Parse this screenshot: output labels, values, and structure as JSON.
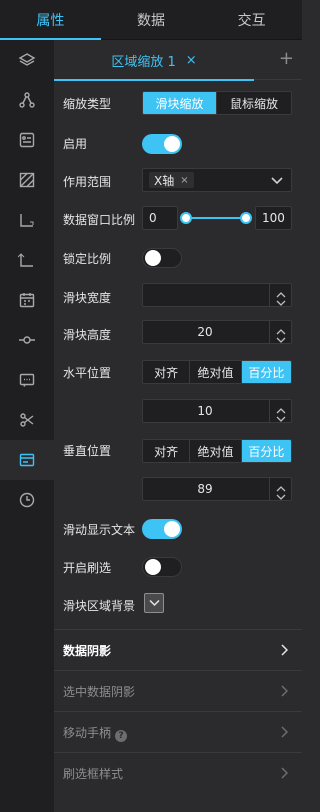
{
  "top_tabs": [
    {
      "label": "属性",
      "active": true
    },
    {
      "label": "数据",
      "active": false
    },
    {
      "label": "交互",
      "active": false
    }
  ],
  "rail_icons": [
    "layers-icon",
    "graph-nodes-icon",
    "card-list-icon",
    "texture-icon",
    "axis-x-icon",
    "axis-y-icon",
    "calendar-icon",
    "timeline-icon",
    "message-icon",
    "scissors-icon",
    "data-zoom-icon",
    "clock-icon"
  ],
  "sub_tab": {
    "label": "区域缩放 1",
    "close": "×",
    "add": "+"
  },
  "zoom_type": {
    "label": "缩放类型",
    "options": [
      "滑块缩放",
      "鼠标缩放"
    ],
    "selected": "滑块缩放"
  },
  "enabled": {
    "label": "启用",
    "value": true
  },
  "scope": {
    "label": "作用范围",
    "tag": "X轴",
    "tag_close": "×"
  },
  "window_ratio": {
    "label": "数据窗口比例",
    "start": "0",
    "end": "100"
  },
  "lock_ratio": {
    "label": "锁定比例",
    "value": false
  },
  "slider_width": {
    "label": "滑块宽度",
    "value": ""
  },
  "slider_height": {
    "label": "滑块高度",
    "value": "20"
  },
  "h_position": {
    "label": "水平位置",
    "options": [
      "对齐",
      "绝对值",
      "百分比"
    ],
    "selected": "百分比",
    "value": "10"
  },
  "v_position": {
    "label": "垂直位置",
    "options": [
      "对齐",
      "绝对值",
      "百分比"
    ],
    "selected": "百分比",
    "value": "89"
  },
  "show_text": {
    "label": "滑动显示文本",
    "value": true
  },
  "brush": {
    "label": "开启刷选",
    "value": false
  },
  "slider_bg": {
    "label": "滑块区域背景"
  },
  "sections": [
    {
      "label": "数据阴影",
      "enabled": true
    },
    {
      "label": "选中数据阴影",
      "enabled": false
    },
    {
      "label": "移动手柄",
      "enabled": false,
      "help": "?"
    },
    {
      "label": "刷选框样式",
      "enabled": false
    }
  ]
}
